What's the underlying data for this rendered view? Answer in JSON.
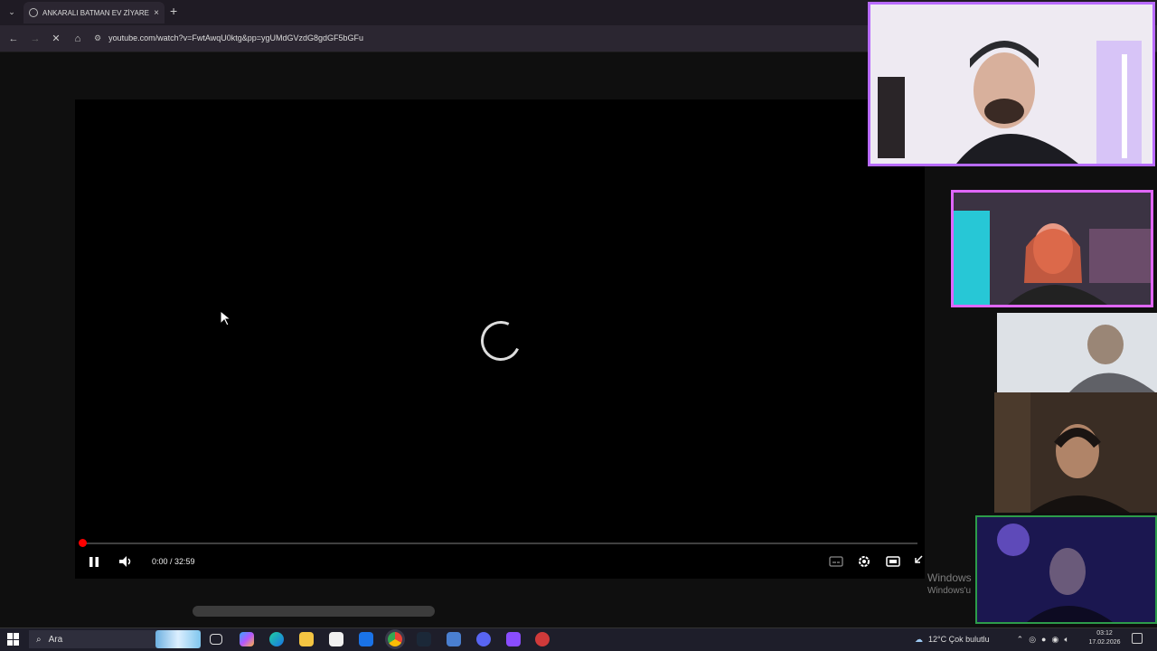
{
  "browser": {
    "tab_title": "ANKARALI BATMAN EV ZİYARETİ",
    "tab_close": "×",
    "new_tab": "+",
    "url": "youtube.com/watch?v=FwtAwqU0ktg&pp=ygUMdGVzdG8gdGF5bGFu",
    "icons": [
      "back-icon",
      "forward-icon",
      "stop-icon",
      "home-icon",
      "site-settings-icon"
    ]
  },
  "player": {
    "time_display": "0:00 / 32:59",
    "progress_fraction": 0.0,
    "state": "loading",
    "accent_color": "#ff0000"
  },
  "overlay": {
    "watermark_line1": "Windows",
    "watermark_line2": "Windows'u"
  },
  "taskbar": {
    "search_label": "Ara",
    "weather": "12°C  Çok bulutlu",
    "time": "03:12",
    "date": "17.02.2026",
    "apps": [
      "task-view-icon",
      "copilot-icon",
      "edge-icon",
      "file-explorer-icon",
      "store-icon",
      "outlook-icon",
      "chrome-icon",
      "steam-icon",
      "app-icon",
      "discord-icon",
      "app-icon",
      "app-icon"
    ]
  }
}
